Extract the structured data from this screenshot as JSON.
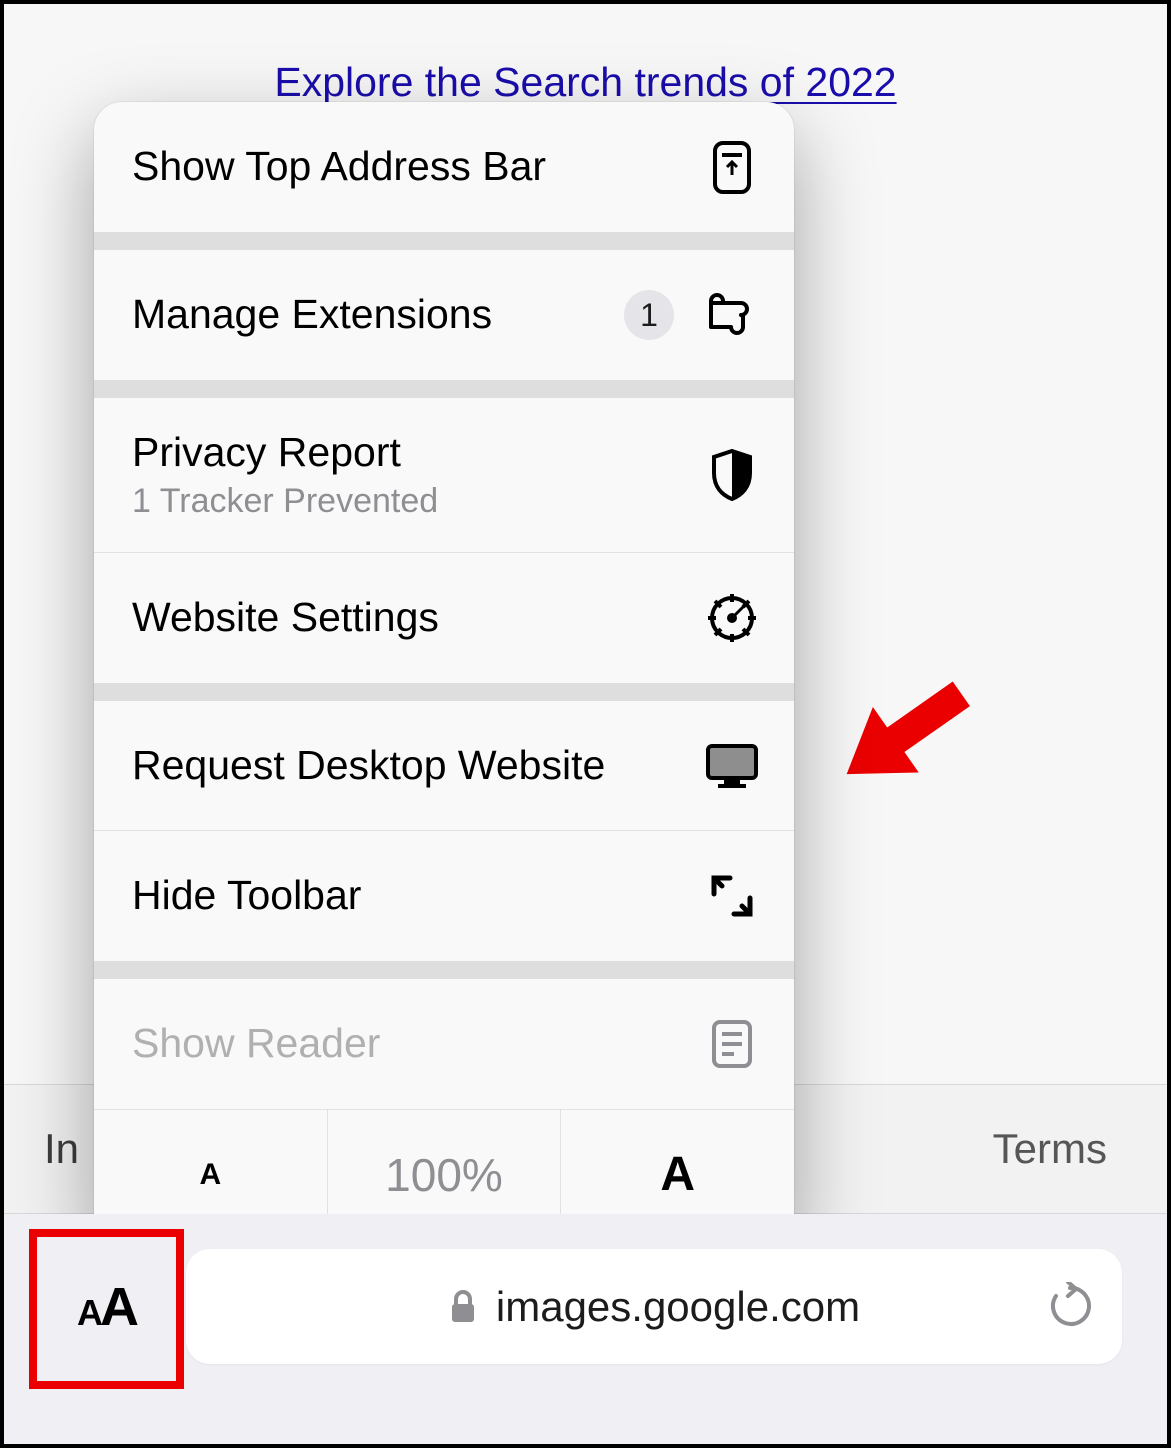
{
  "page": {
    "trend_link": "Explore the Search trends of 2022",
    "footer_left": "In",
    "footer_right": "Terms"
  },
  "address": {
    "url": "images.google.com"
  },
  "menu": {
    "show_top_bar": "Show Top Address Bar",
    "manage_ext": "Manage Extensions",
    "ext_badge": "1",
    "privacy": "Privacy Report",
    "privacy_sub": "1 Tracker Prevented",
    "website_settings": "Website Settings",
    "request_desktop": "Request Desktop Website",
    "hide_toolbar": "Hide Toolbar",
    "show_reader": "Show Reader",
    "zoom_level": "100%",
    "zoom_small": "A",
    "zoom_big": "A"
  }
}
